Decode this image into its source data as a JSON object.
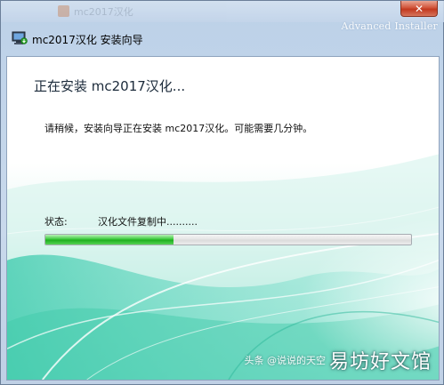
{
  "background_window": {
    "title": "mc2017汉化"
  },
  "branding": {
    "advanced_installer": "Advanced Installer"
  },
  "window": {
    "title": "mc2017汉化 安装向导",
    "close_glyph": "✕"
  },
  "main": {
    "heading": "正在安装 mc2017汉化...",
    "description": "请稍候，安装向导正在安装 mc2017汉化。可能需要几分钟。",
    "status_label": "状态:",
    "status_value": "汉化文件复制中..........",
    "progress_fraction": 0.35
  },
  "watermark": {
    "small": "头条 @说说的天空",
    "big": "易坊好文馆"
  },
  "colors": {
    "progress_green": "#2ebd2e",
    "teal_swirl": "#49d3b6",
    "titlebar_blue": "#c4d5ea"
  },
  "icons": {
    "app_icon": "installer-monitor-icon",
    "close": "close-icon"
  }
}
